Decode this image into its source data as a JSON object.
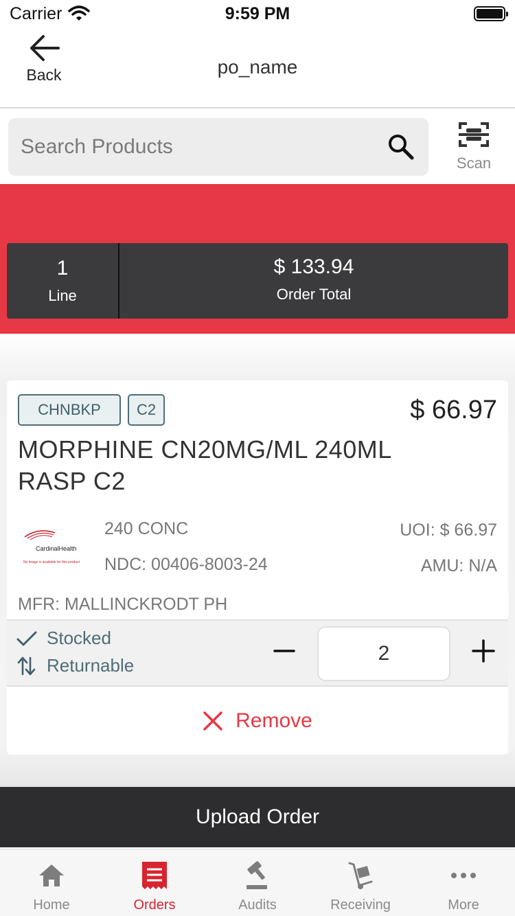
{
  "status_bar": {
    "carrier": "Carrier",
    "time": "9:59 PM"
  },
  "nav": {
    "back_label": "Back",
    "title": "po_name"
  },
  "search": {
    "placeholder": "Search Products",
    "scan_label": "Scan"
  },
  "summary": {
    "lines_count": "1",
    "lines_label": "Line",
    "order_total": "$ 133.94",
    "order_total_label": "Order Total"
  },
  "product": {
    "tags": [
      "CHNBKP",
      "C2"
    ],
    "price": "$ 66.97",
    "name": "MORPHINE CN20MG/ML 240ML RASP  C2",
    "thumbnail_brand": "CardinalHealth",
    "thumbnail_note": "No image is available for this product",
    "pack": "240 CONC",
    "ndc": "NDC: 00406-8003-24",
    "uoi": "UOI: $ 66.97",
    "amu": "AMU: N/A",
    "mfr": "MFR: MALLINCKRODT PH",
    "flags": [
      "Stocked",
      "Returnable"
    ],
    "quantity": "2",
    "remove_label": "Remove"
  },
  "upload_label": "Upload Order",
  "tabs": [
    {
      "label": "Home",
      "icon": "home-icon",
      "active": false
    },
    {
      "label": "Orders",
      "icon": "orders-icon",
      "active": true
    },
    {
      "label": "Audits",
      "icon": "audits-icon",
      "active": false
    },
    {
      "label": "Receiving",
      "icon": "receiving-icon",
      "active": false
    },
    {
      "label": "More",
      "icon": "more-icon",
      "active": false
    }
  ],
  "colors": {
    "brand_red": "#e73845",
    "dark_panel": "#3b3b3d",
    "tag_teal": "#4e6d78",
    "active_tab": "#d8242f"
  }
}
